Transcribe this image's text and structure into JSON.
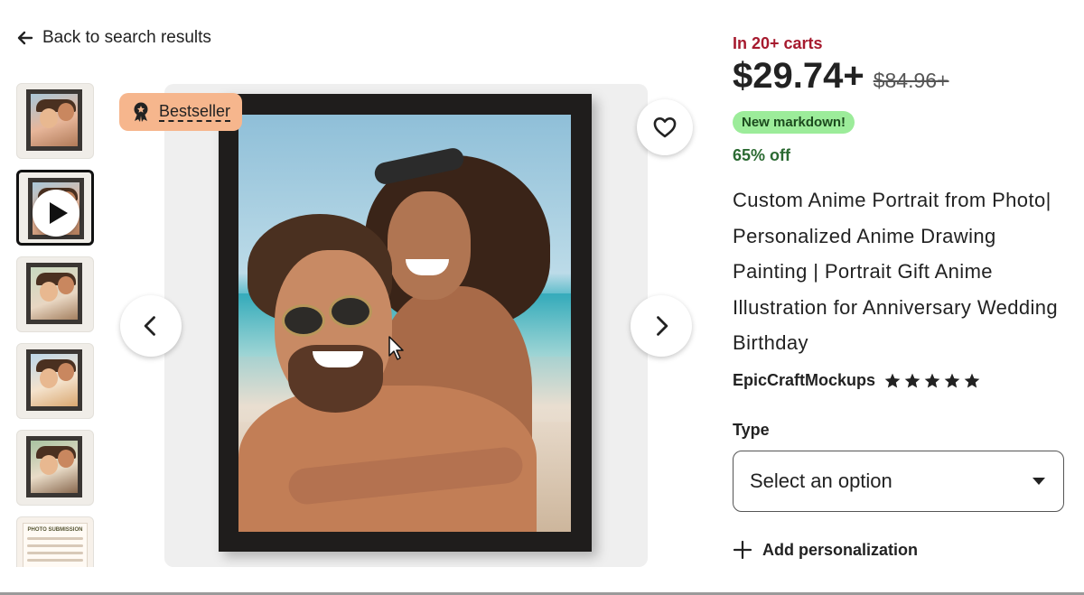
{
  "nav": {
    "back_label": "Back to search results"
  },
  "gallery": {
    "badge_label": "Bestseller",
    "thumb_doc_title": "PHOTO SUBMISSION",
    "selected_thumb_index": 1,
    "accent_badge_color": "#f6b68d"
  },
  "product": {
    "in_carts": "In 20+ carts",
    "price": "$29.74+",
    "original_price": "$84.96+",
    "markdown_label": "New markdown!",
    "discount": "65% off",
    "title": "Custom Anime Portrait from Photo| Personalized Anime Drawing Painting | Portrait Gift Anime Illustration for Anniversary Wedding Birthday",
    "shop_name": "EpicCraftMockups",
    "rating_stars": 5,
    "price_color": "#222222",
    "cart_color": "#a61a2e",
    "markdown_color": "#9cec9a"
  },
  "options": {
    "type_label": "Type",
    "type_selected": "Select an option",
    "add_personalization_label": "Add personalization"
  }
}
